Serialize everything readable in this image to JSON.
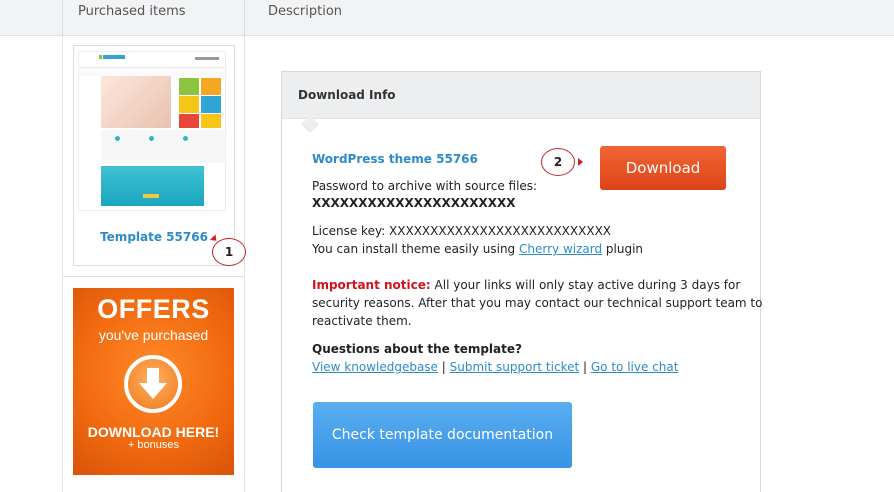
{
  "header": {
    "tab_purchased": "Purchased items",
    "tab_description": "Description"
  },
  "sidebar": {
    "template_title": "Template 55766",
    "marker_1": "1",
    "promo": {
      "title": "OFFERS",
      "subtitle": "you've purchased",
      "cta": "DOWNLOAD HERE!",
      "bonus": "+ bonuses"
    }
  },
  "download_info": {
    "heading": "Download Info",
    "theme_name": "WordPress theme 55766",
    "password_label": "Password to archive with source files:",
    "password_value": "XXXXXXXXXXXXXXXXXXXXXX",
    "license_line": "License key: XXXXXXXXXXXXXXXXXXXXXXXXXXX",
    "install_prefix": "You can install theme easily using",
    "install_link": "Cherry wizard",
    "install_suffix": "plugin",
    "notice_label": "Important notice:",
    "notice_line1": "All your links will only stay active during 3 days for",
    "notice_line2": "security reasons. After that you may contact our technical support team to",
    "notice_line3": "reactivate them.",
    "questions_label": "Questions about the template?",
    "link_kb": "View knowledgebase",
    "link_ticket": "Submit support ticket",
    "link_chat": "Go to live chat",
    "separator": "|",
    "marker_2": "2",
    "download_button": "Download",
    "doc_button": "Check template documentation"
  },
  "colors": {
    "accent_blue": "#2e8bc9",
    "download_orange": "#e8502a",
    "doc_blue": "#4aa3ec",
    "notice_red": "#d0141c"
  },
  "icons": [
    "download-arrow-icon",
    "pointer-arrow-icon"
  ]
}
